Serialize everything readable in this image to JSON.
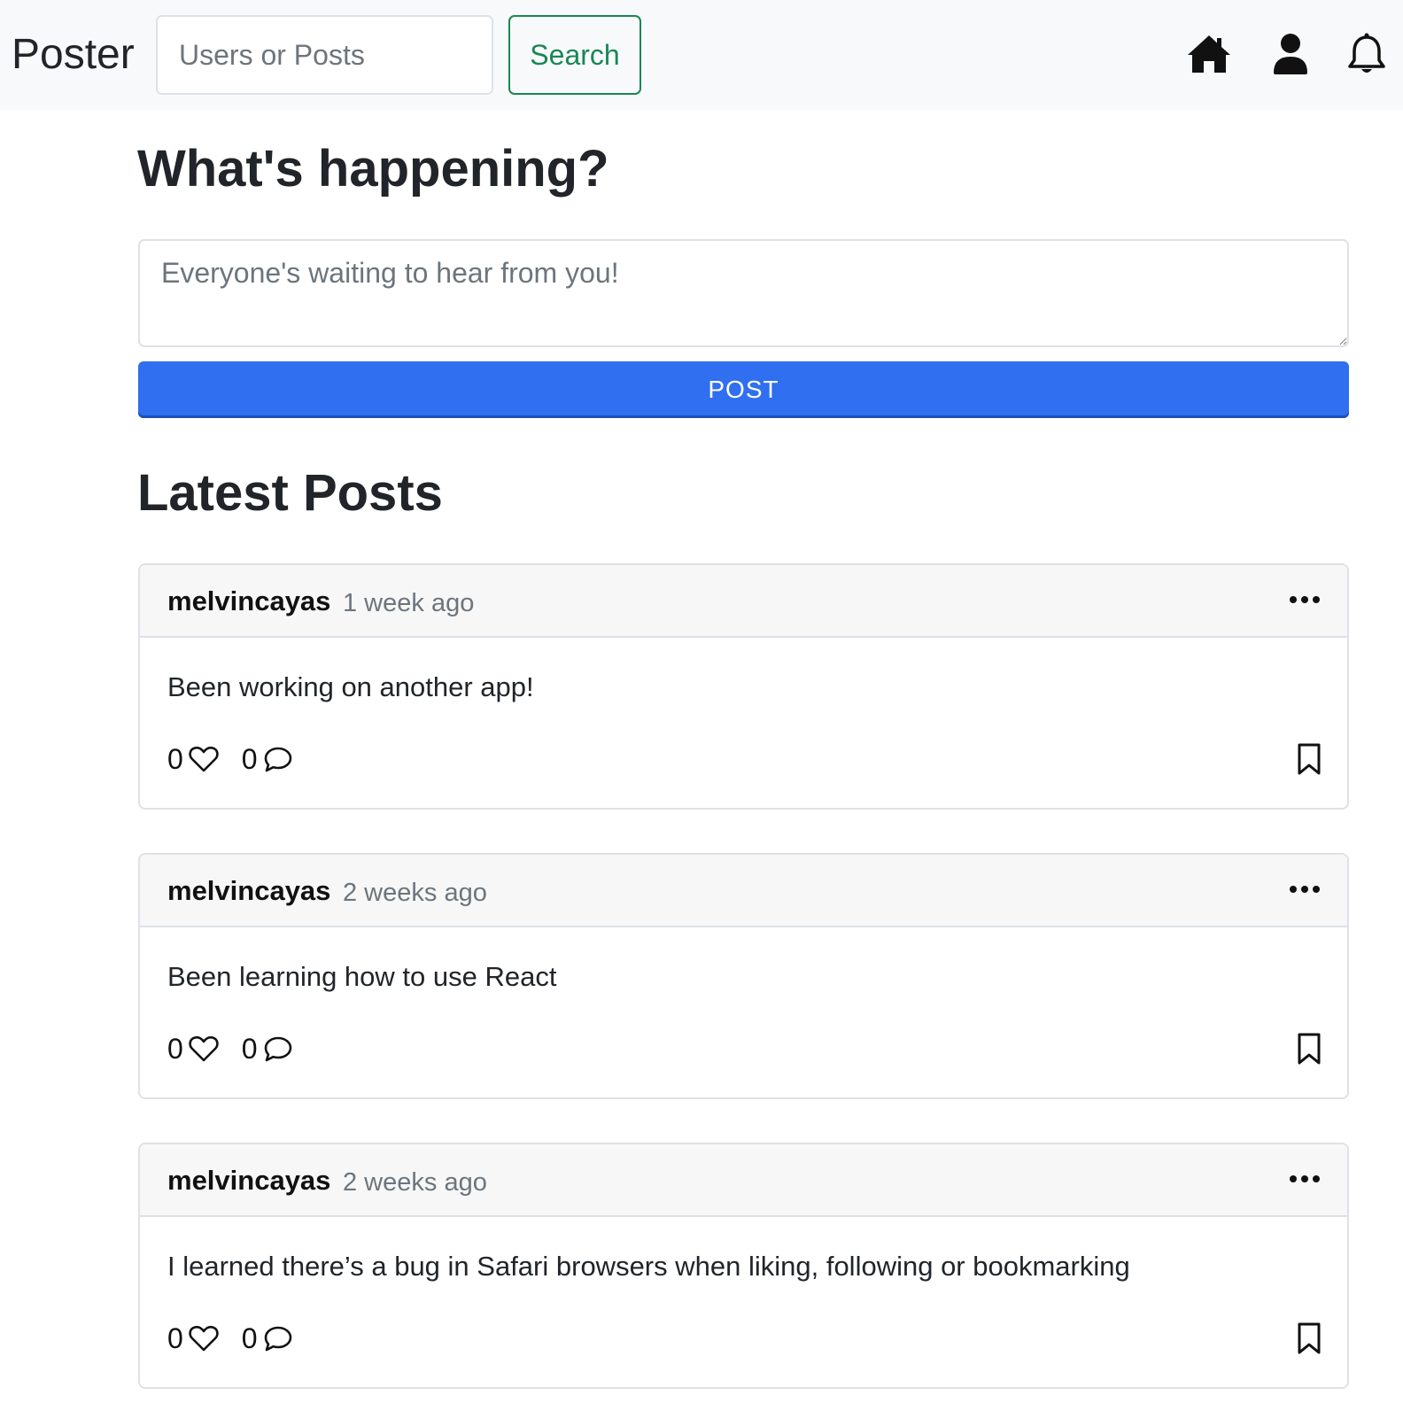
{
  "navbar": {
    "brand": "Poster",
    "search_placeholder": "Users or Posts",
    "search_value": "",
    "search_button": "Search",
    "icons": [
      "home-icon",
      "user-icon",
      "bell-icon"
    ]
  },
  "compose": {
    "title": "What's happening?",
    "placeholder": "Everyone's waiting to hear from you!",
    "value": "",
    "post_button": "POST"
  },
  "feed": {
    "title": "Latest Posts",
    "posts": [
      {
        "username": "melvincayas",
        "time": "1 week ago",
        "body": "Been working on another app!",
        "likes": "0",
        "comments": "0"
      },
      {
        "username": "melvincayas",
        "time": "2 weeks ago",
        "body": "Been learning how to use React",
        "likes": "0",
        "comments": "0"
      },
      {
        "username": "melvincayas",
        "time": "2 weeks ago",
        "body": "I learned there’s a bug in Safari browsers when liking, following or bookmarking",
        "likes": "0",
        "comments": "0"
      }
    ]
  },
  "colors": {
    "navbar_bg": "#f8f9fa",
    "search_green": "#198754",
    "post_blue": "#2f6ff0",
    "card_header_bg": "#f7f7f7",
    "muted_text": "#6c757d"
  }
}
